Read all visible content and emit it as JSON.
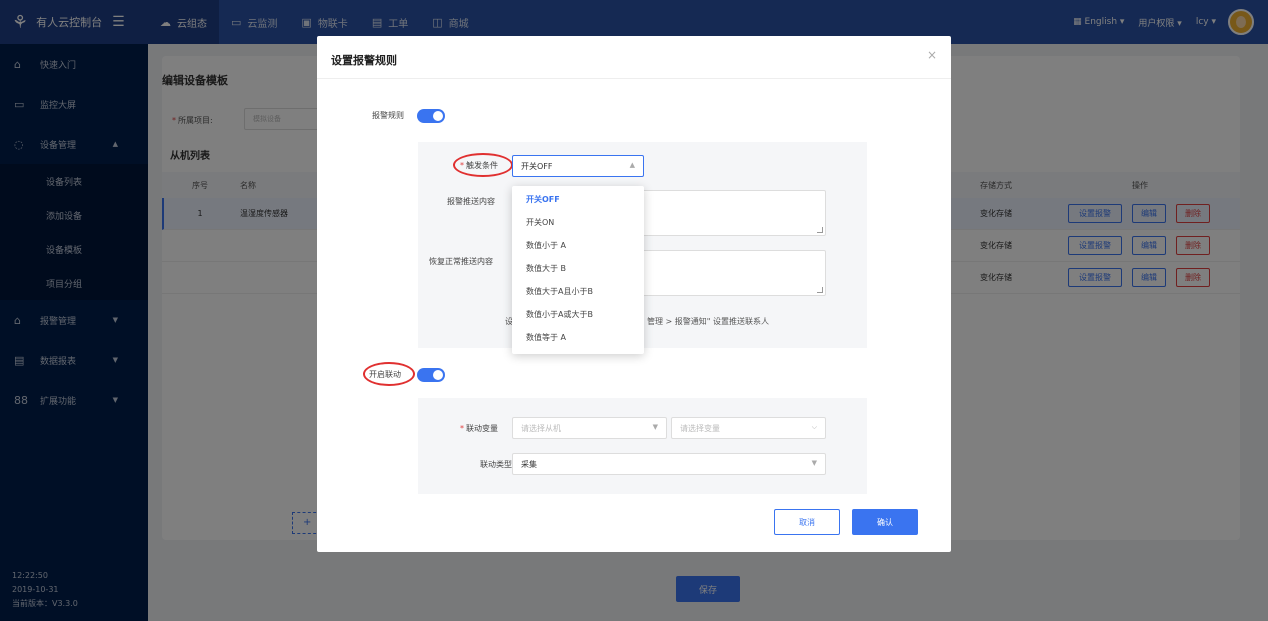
{
  "brand": {
    "name": "有人云控制台",
    "menu_icon": "hamburger-icon"
  },
  "topnav": [
    {
      "label": "云组态",
      "icon": "cloud-icon"
    },
    {
      "label": "云监测",
      "icon": "monitor-icon"
    },
    {
      "label": "物联卡",
      "icon": "sim-card-icon"
    },
    {
      "label": "工单",
      "icon": "ticket-icon"
    },
    {
      "label": "商城",
      "icon": "shop-icon"
    }
  ],
  "topright": {
    "language": "English",
    "permissions": "用户权限",
    "user": "lcy"
  },
  "sidebar": {
    "items": [
      {
        "label": "快速入门",
        "icon": "home-icon"
      },
      {
        "label": "监控大屏",
        "icon": "monitor-icon"
      },
      {
        "label": "设备管理",
        "icon": "device-icon"
      },
      {
        "label": "报警管理",
        "icon": "alarm-icon"
      },
      {
        "label": "数据报表",
        "icon": "report-icon"
      },
      {
        "label": "扩展功能",
        "icon": "extension-icon"
      }
    ],
    "sub_items": [
      "设备列表",
      "添加设备",
      "设备模板",
      "项目分组"
    ],
    "time": "12:22:50",
    "date": "2019-10-31",
    "version": "当前版本：V3.3.0"
  },
  "page": {
    "title": "编辑设备模板",
    "project_label": "所属项目:",
    "project_value": "模拟设备",
    "list_title": "从机列表",
    "columns": {
      "no": "序号",
      "name": "名称",
      "storage": "存储方式",
      "ops": "操作"
    },
    "rows": [
      {
        "no": "1",
        "name": "温湿度传感器",
        "storage": "变化存储"
      },
      {
        "no": "",
        "name": "",
        "storage": "变化存储"
      },
      {
        "no": "",
        "name": "",
        "storage": "变化存储"
      }
    ],
    "btn_set_alarm": "设置报警",
    "btn_edit": "编辑",
    "btn_delete": "删除",
    "add_button": "+",
    "save_button": "保存"
  },
  "modal": {
    "title": "设置报警规则",
    "alarm_rule_label": "报警规则",
    "trigger_label": "触发条件",
    "trigger_value": "开关OFF",
    "push_content_label": "报警推送内容",
    "recover_label": "恢复正常推送内容",
    "hint_prefix": "设",
    "hint_suffix": "管理 > 报警通知\" 设置推送联系人",
    "linkage_label": "开启联动",
    "linkage_var_label": "联动变量",
    "slave_placeholder": "请选择从机",
    "var_placeholder": "请选择变量",
    "linkage_type_label": "联动类型",
    "linkage_type_value": "采集",
    "cancel": "取消",
    "confirm": "确认",
    "options": [
      "开关OFF",
      "开关ON",
      "数值小于 A",
      "数值大于 B",
      "数值大于A且小于B",
      "数值小于A或大于B",
      "数值等于 A"
    ]
  }
}
